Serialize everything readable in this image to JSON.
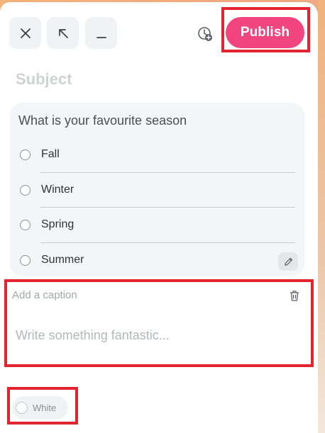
{
  "toolbar": {
    "close_icon": "close-icon",
    "expand_icon": "arrow-up-left-icon",
    "minimize_icon": "minimize-icon",
    "schedule_icon": "schedule-icon",
    "publish_label": "Publish"
  },
  "post": {
    "subject_placeholder": "Subject"
  },
  "poll": {
    "question": "What is your favourite season",
    "options": [
      "Fall",
      "Winter",
      "Spring",
      "Summer"
    ],
    "edit_icon": "pencil-icon"
  },
  "caption": {
    "label": "Add a caption",
    "placeholder": "Write something fantastic...",
    "delete_icon": "trash-icon"
  },
  "color_option": {
    "label": "White",
    "swatch_color": "#ffffff"
  },
  "colors": {
    "accent": "#f2457f",
    "highlight": "#e1242f"
  }
}
